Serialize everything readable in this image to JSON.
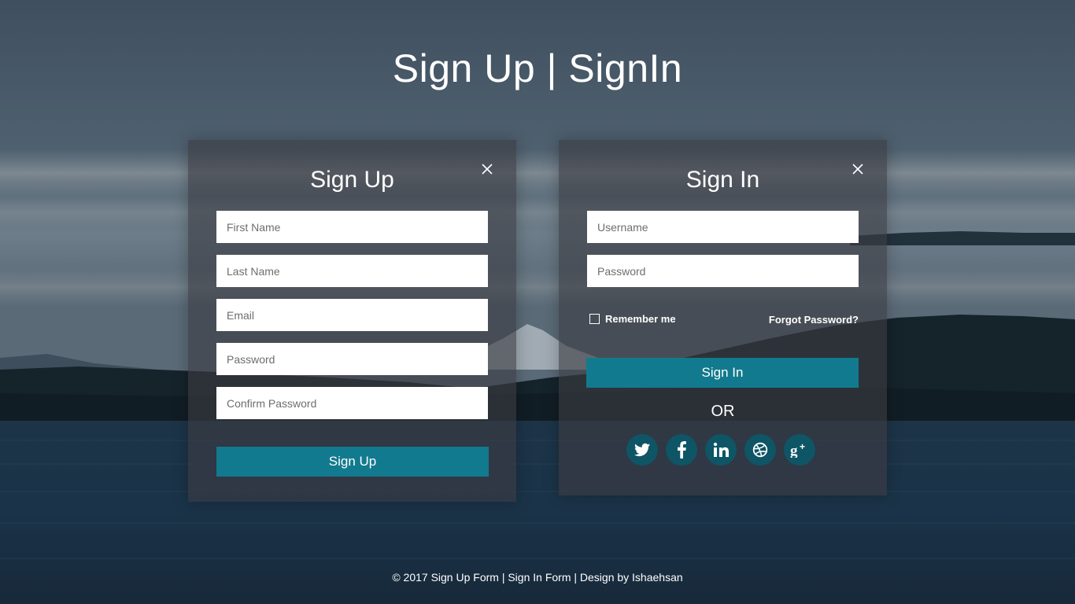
{
  "page": {
    "title": "Sign Up | SignIn"
  },
  "signup": {
    "title": "Sign Up",
    "first_name_placeholder": "First Name",
    "last_name_placeholder": "Last Name",
    "email_placeholder": "Email",
    "password_placeholder": "Password",
    "confirm_password_placeholder": "Confirm Password",
    "button_label": "Sign Up",
    "close_icon": "close-icon"
  },
  "signin": {
    "title": "Sign In",
    "username_placeholder": "Username",
    "password_placeholder": "Password",
    "remember_label": "Remember me",
    "remember_checked": false,
    "forgot_label": "Forgot Password?",
    "button_label": "Sign In",
    "or_label": "OR",
    "close_icon": "close-icon",
    "social_icons": [
      "twitter-icon",
      "facebook-icon",
      "linkedin-icon",
      "dribbble-icon",
      "google-plus-icon"
    ]
  },
  "footer": {
    "text": "© 2017 Sign Up Form | Sign In Form | Design by Ishaehsan"
  },
  "colors": {
    "accent": "#127a8e",
    "social_bg": "#0e5566",
    "panel_bg": "rgba(60,60,66,0.62)",
    "text": "#ffffff"
  }
}
